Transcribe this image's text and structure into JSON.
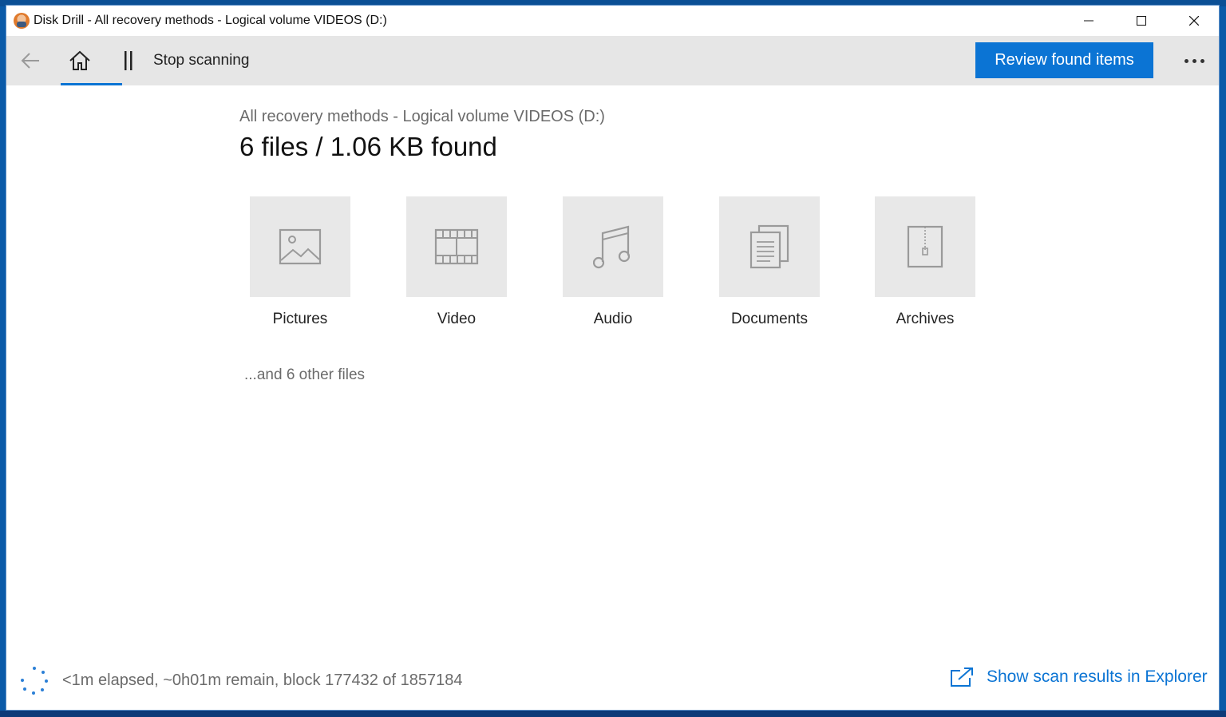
{
  "window": {
    "title": "Disk Drill - All recovery methods - Logical volume VIDEOS (D:)"
  },
  "toolbar": {
    "stop_label": "Stop scanning",
    "review_label": "Review found items"
  },
  "main": {
    "subtitle": "All recovery methods - Logical volume VIDEOS (D:)",
    "headline": "6 files / 1.06 KB found",
    "categories": [
      {
        "label": "Pictures",
        "icon": "picture-icon"
      },
      {
        "label": "Video",
        "icon": "film-icon"
      },
      {
        "label": "Audio",
        "icon": "music-note-icon"
      },
      {
        "label": "Documents",
        "icon": "documents-icon"
      },
      {
        "label": "Archives",
        "icon": "archive-icon"
      }
    ],
    "other_files": "...and 6 other files"
  },
  "footer": {
    "status": "<1m elapsed, ~0h01m remain, block 177432 of 1857184",
    "explorer_link": "Show scan results in Explorer"
  },
  "colors": {
    "accent": "#0b74d4",
    "toolbar_bg": "#e6e6e6",
    "tile_bg": "#e8e8e8",
    "icon_gray": "#9a9a9a"
  }
}
